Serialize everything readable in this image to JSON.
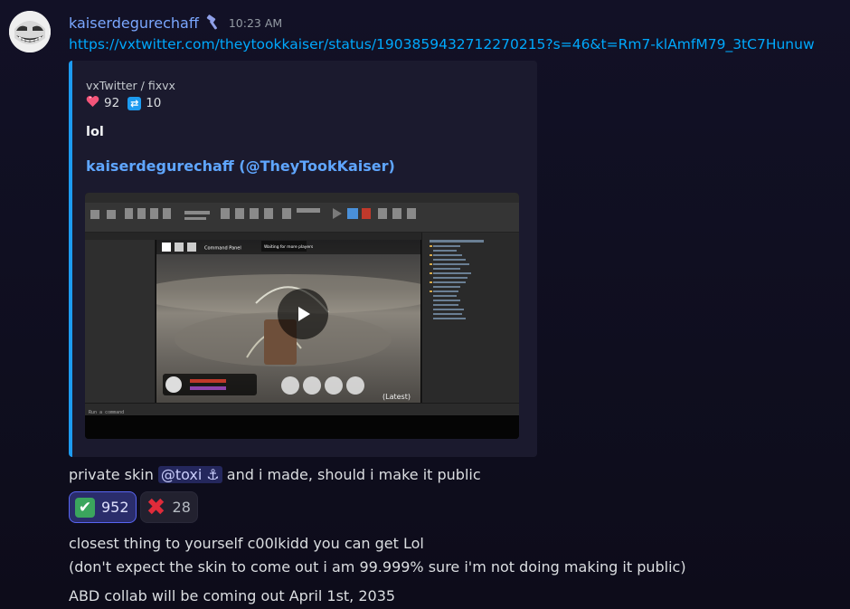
{
  "message": {
    "username": "kaiserdegurechaff",
    "role_icon": "hammer-icon",
    "timestamp": "10:23 AM",
    "link": "https://vxtwitter.com/theytookkaiser/status/1903859432712270215?s=46&t=Rm7-klAmfM79_3tC7Hunuw"
  },
  "embed": {
    "provider": "vxTwitter / fixvx",
    "likes_icon": "heart-icon",
    "likes": "92",
    "retweets_icon": "retweet-icon",
    "retweets": "10",
    "description": "lol",
    "author": "kaiserdegurechaff (@TheyTookKaiser)",
    "accent_color": "#1d9bf0",
    "video_inner_text": {
      "hud_banner": "Waiting for more players",
      "command_panel": "Command Panel",
      "command_bar": "Run a command",
      "game_label": "(Latest)"
    }
  },
  "caption": {
    "before": "private skin",
    "mention": "@toxi ⚓",
    "after": "and i made, should i make it public"
  },
  "reactions": [
    {
      "emoji": "✔",
      "emoji_name": "check-mark-icon",
      "count": "952",
      "me": true
    },
    {
      "emoji": "✖",
      "emoji_name": "cross-mark-icon",
      "count": "28",
      "me": false
    }
  ],
  "followups": [
    "closest thing to yourself c00lkidd you can get Lol",
    "(don't expect the skin to come out i am 99.999% sure i'm not doing making it public)",
    "ABD collab will be coming out April 1st, 2035"
  ],
  "colors": {
    "username": "#7aa7ff",
    "link": "#00a8fc",
    "mention_bg": "#3a3f8f",
    "reaction_selected": "#5865f2"
  }
}
